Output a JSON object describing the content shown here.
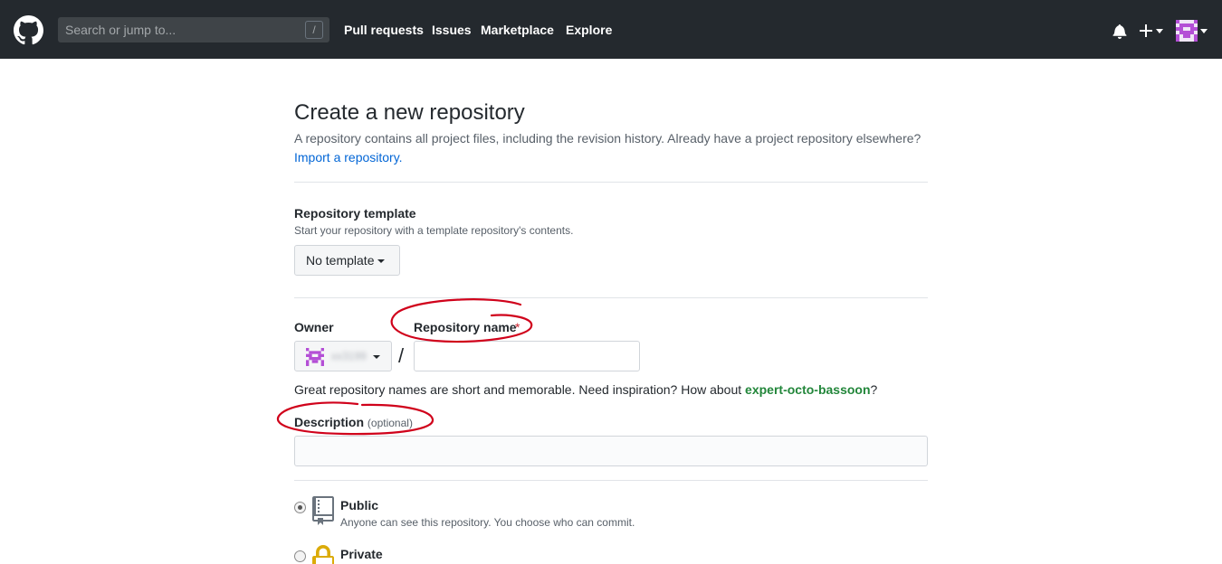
{
  "header": {
    "search_placeholder": "Search or jump to...",
    "search_key": "/",
    "nav": {
      "pull_requests": "Pull requests",
      "issues": "Issues",
      "marketplace": "Marketplace",
      "explore": "Explore"
    },
    "plus_label": "+"
  },
  "main": {
    "title": "Create a new repository",
    "subtitle": "A repository contains all project files, including the revision history. Already have a project repository elsewhere?",
    "import_link": "Import a repository.",
    "template": {
      "label": "Repository template",
      "note": "Start your repository with a template repository's contents.",
      "button": "No template"
    },
    "owner": {
      "label": "Owner",
      "name": "xx3199"
    },
    "repo_name": {
      "label": "Repository name",
      "required_mark": "*",
      "value": ""
    },
    "slash": "/",
    "hint": {
      "text": "Great repository names are short and memorable. Need inspiration? How about ",
      "suggestion": "expert-octo-bassoon",
      "suffix": "?"
    },
    "description": {
      "label": "Description",
      "optional": "(optional)",
      "value": ""
    },
    "visibility": {
      "public": {
        "title": "Public",
        "desc": "Anyone can see this repository. You choose who can commit."
      },
      "private": {
        "title": "Private"
      }
    }
  },
  "colors": {
    "header_bg": "#24292e",
    "link": "#0366d6",
    "suggestion": "#22863a",
    "annotation": "#d0021b",
    "avatar": "#b44fd6"
  }
}
